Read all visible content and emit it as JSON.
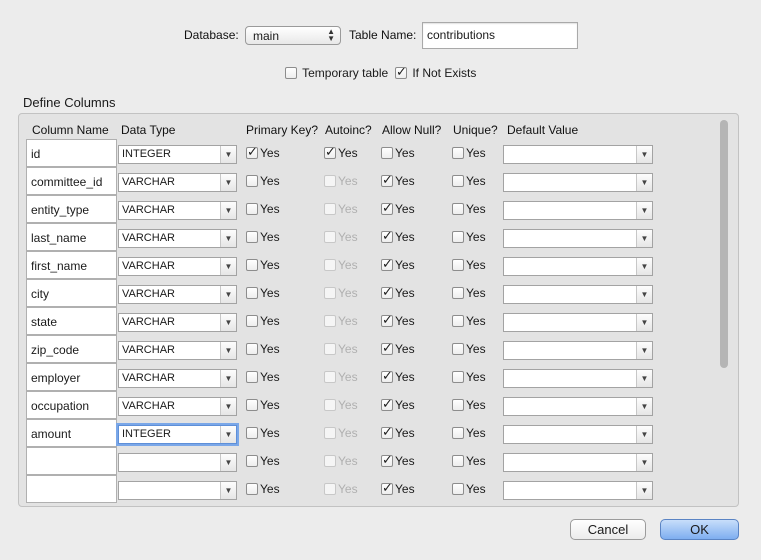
{
  "form": {
    "database_label": "Database:",
    "database_value": "main",
    "table_name_label": "Table Name:",
    "table_name_value": "contributions",
    "temporary_label": "Temporary table",
    "temporary_checked": false,
    "if_not_exists_label": "If Not Exists",
    "if_not_exists_checked": true
  },
  "section_title": "Define Columns",
  "headers": {
    "column_name": "Column Name",
    "data_type": "Data Type",
    "primary_key": "Primary Key?",
    "autoinc": "Autoinc?",
    "allow_null": "Allow Null?",
    "unique": "Unique?",
    "default_value": "Default Value"
  },
  "yes_label": "Yes",
  "rows": [
    {
      "name": "id",
      "type": "INTEGER",
      "pk": true,
      "ai": true,
      "ai_disabled": false,
      "null": false,
      "unique": false,
      "default": ""
    },
    {
      "name": "committee_id",
      "type": "VARCHAR",
      "pk": false,
      "ai": false,
      "ai_disabled": true,
      "null": true,
      "unique": false,
      "default": ""
    },
    {
      "name": "entity_type",
      "type": "VARCHAR",
      "pk": false,
      "ai": false,
      "ai_disabled": true,
      "null": true,
      "unique": false,
      "default": ""
    },
    {
      "name": "last_name",
      "type": "VARCHAR",
      "pk": false,
      "ai": false,
      "ai_disabled": true,
      "null": true,
      "unique": false,
      "default": ""
    },
    {
      "name": "first_name",
      "type": "VARCHAR",
      "pk": false,
      "ai": false,
      "ai_disabled": true,
      "null": true,
      "unique": false,
      "default": ""
    },
    {
      "name": "city",
      "type": "VARCHAR",
      "pk": false,
      "ai": false,
      "ai_disabled": true,
      "null": true,
      "unique": false,
      "default": ""
    },
    {
      "name": "state",
      "type": "VARCHAR",
      "pk": false,
      "ai": false,
      "ai_disabled": true,
      "null": true,
      "unique": false,
      "default": ""
    },
    {
      "name": "zip_code",
      "type": "VARCHAR",
      "pk": false,
      "ai": false,
      "ai_disabled": true,
      "null": true,
      "unique": false,
      "default": ""
    },
    {
      "name": "employer",
      "type": "VARCHAR",
      "pk": false,
      "ai": false,
      "ai_disabled": true,
      "null": true,
      "unique": false,
      "default": ""
    },
    {
      "name": "occupation",
      "type": "VARCHAR",
      "pk": false,
      "ai": false,
      "ai_disabled": true,
      "null": true,
      "unique": false,
      "default": ""
    },
    {
      "name": "amount",
      "type": "INTEGER",
      "pk": false,
      "ai": false,
      "ai_disabled": true,
      "null": true,
      "unique": false,
      "default": "",
      "focused": true
    },
    {
      "name": "",
      "type": "",
      "pk": false,
      "ai": false,
      "ai_disabled": true,
      "null": true,
      "unique": false,
      "default": ""
    },
    {
      "name": "",
      "type": "",
      "pk": false,
      "ai": false,
      "ai_disabled": true,
      "null": true,
      "unique": false,
      "default": ""
    }
  ],
  "buttons": {
    "cancel": "Cancel",
    "ok": "OK"
  },
  "icons": {
    "popup": "updown-arrows-icon",
    "combo": "chevron-down-icon",
    "check": "checkmark-icon"
  },
  "colors": {
    "background": "#ececec",
    "ok_button": "#7eaef0",
    "focus_ring": "#7aa7e8"
  }
}
